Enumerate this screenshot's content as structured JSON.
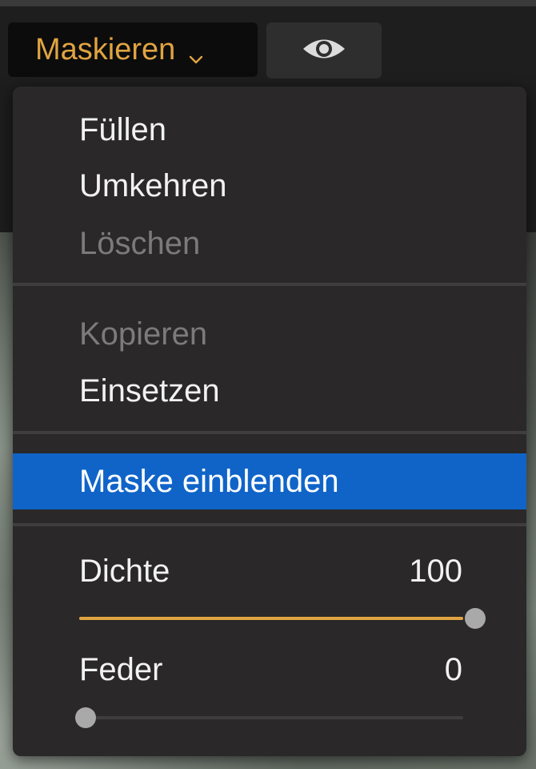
{
  "toolbar": {
    "mask_button_label": "Maskieren",
    "mask_button_color": "#e0a441",
    "eye_icon": "eye-icon"
  },
  "menu": {
    "items": [
      {
        "label": "Füllen",
        "enabled": true
      },
      {
        "label": "Umkehren",
        "enabled": true
      },
      {
        "label": "Löschen",
        "enabled": false
      },
      {
        "label": "Kopieren",
        "enabled": false
      },
      {
        "label": "Einsetzen",
        "enabled": true
      },
      {
        "label": "Maske einblenden",
        "enabled": true,
        "highlighted": true
      }
    ],
    "highlight_color": "#1064c8"
  },
  "sliders": {
    "density": {
      "label": "Dichte",
      "value": "100",
      "fraction": 1.0
    },
    "feather": {
      "label": "Feder",
      "value": "0",
      "fraction": 0.0
    },
    "accent_color": "#e0a441"
  }
}
